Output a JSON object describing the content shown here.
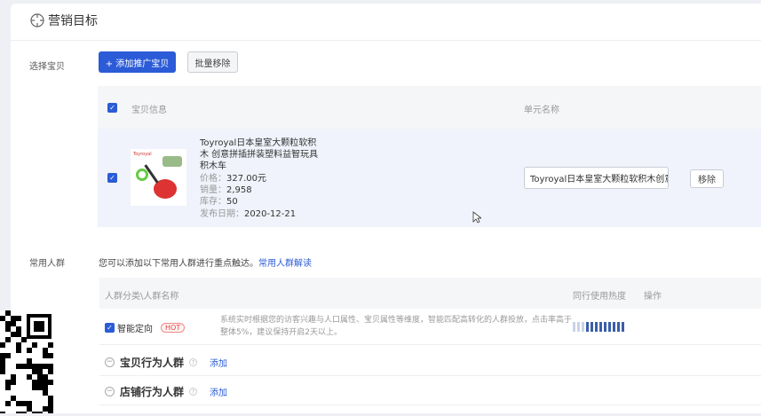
{
  "header": {
    "title": "营销目标",
    "icon": "crosshair-icon"
  },
  "product_section": {
    "label": "选择宝贝",
    "add_button": "+ 添加推广宝贝",
    "batch_remove_button": "批量移除",
    "columns": [
      "宝贝信息",
      "单元名称"
    ],
    "item": {
      "title": "Toyroyal日本皇室大颗粒软积木 创意拼插拼装塑料益智玩具积木车",
      "image_label": "Toyroyal",
      "price_label": "价格：",
      "price": "327.00元",
      "sales_label": "销量：",
      "sales": "2,958",
      "stock_label": "库存：",
      "stock": "50",
      "date_label": "发布日期：",
      "date": "2020-12-21",
      "unit_name": "Toyroyal日本皇室大颗粒软积木创意",
      "remove_button": "移除"
    }
  },
  "crowd_section": {
    "label": "常用人群",
    "description": "您可以添加以下常用人群进行重点触达。",
    "help_link": "常用人群解读",
    "columns": [
      "人群分类\\人群名称",
      "同行使用热度",
      "操作"
    ],
    "smart": {
      "name": "智能定向",
      "badge": "HOT",
      "desc": "系统实时根据您的访客兴趣与人口属性、宝贝属性等维度，智能匹配高转化的人群投放，点击率高于整体5%，建议保持开启2天以上。",
      "heat": 0.75
    },
    "groups": [
      {
        "name": "宝贝行为人群",
        "action": "添加"
      },
      {
        "name": "店铺行为人群",
        "action": "添加"
      }
    ]
  },
  "colors": {
    "primary": "#2b5bd7",
    "hot": "#d44444"
  }
}
